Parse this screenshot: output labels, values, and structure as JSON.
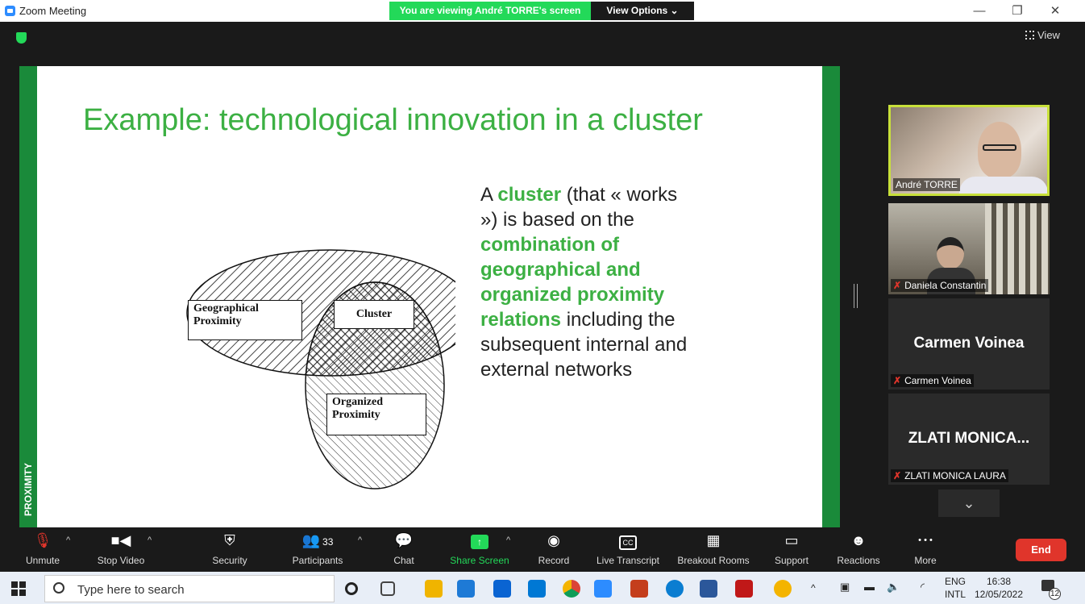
{
  "window": {
    "title": "Zoom Meeting",
    "share_banner": "You are viewing André TORRE's screen",
    "view_options": "View Options ⌄",
    "view_button": "View",
    "minimize": "—",
    "maximize": "❐",
    "close": "✕"
  },
  "slide": {
    "title": "Example: technological innovation in a cluster",
    "brand": "PROXIMITY",
    "text": {
      "p1": "A ",
      "p2": "cluster",
      "p3": " (that « works ») is based on the ",
      "p4": "combination of geographical and organized proximity relations",
      "p5": " including the subsequent internal and external networks"
    },
    "diagram": {
      "label_geo_1": "Geographical",
      "label_geo_2": "Proximity",
      "label_cluster": "Cluster",
      "label_org_1": "Organized",
      "label_org_2": "Proximity"
    }
  },
  "participants": [
    {
      "name": "André TORRE",
      "muted": false
    },
    {
      "name": "Daniela Constantin",
      "muted": true
    },
    {
      "name": "Carmen Voinea",
      "display": "Carmen Voinea",
      "muted": true
    },
    {
      "name": "ZLATI MONICA LAURA",
      "display": "ZLATI  MONICA...",
      "muted": true
    }
  ],
  "toolbar": {
    "unmute": "Unmute",
    "stop_video": "Stop Video",
    "security": "Security",
    "participants": "Participants",
    "participants_count": "33",
    "chat": "Chat",
    "share_screen": "Share Screen",
    "record": "Record",
    "live_transcript": "Live Transcript",
    "cc": "CC",
    "breakout_rooms": "Breakout Rooms",
    "support": "Support",
    "reactions": "Reactions",
    "more": "More",
    "more_icon": "• • •",
    "end": "End"
  },
  "taskbar": {
    "search_placeholder": "Type here to search",
    "lang_1": "ENG",
    "lang_2": "INTL",
    "time": "16:38",
    "date": "12/05/2022",
    "notifications": "12"
  },
  "colors": {
    "accent_green": "#3cb043",
    "zoom_green": "#23D959",
    "end_red": "#e0352b"
  }
}
